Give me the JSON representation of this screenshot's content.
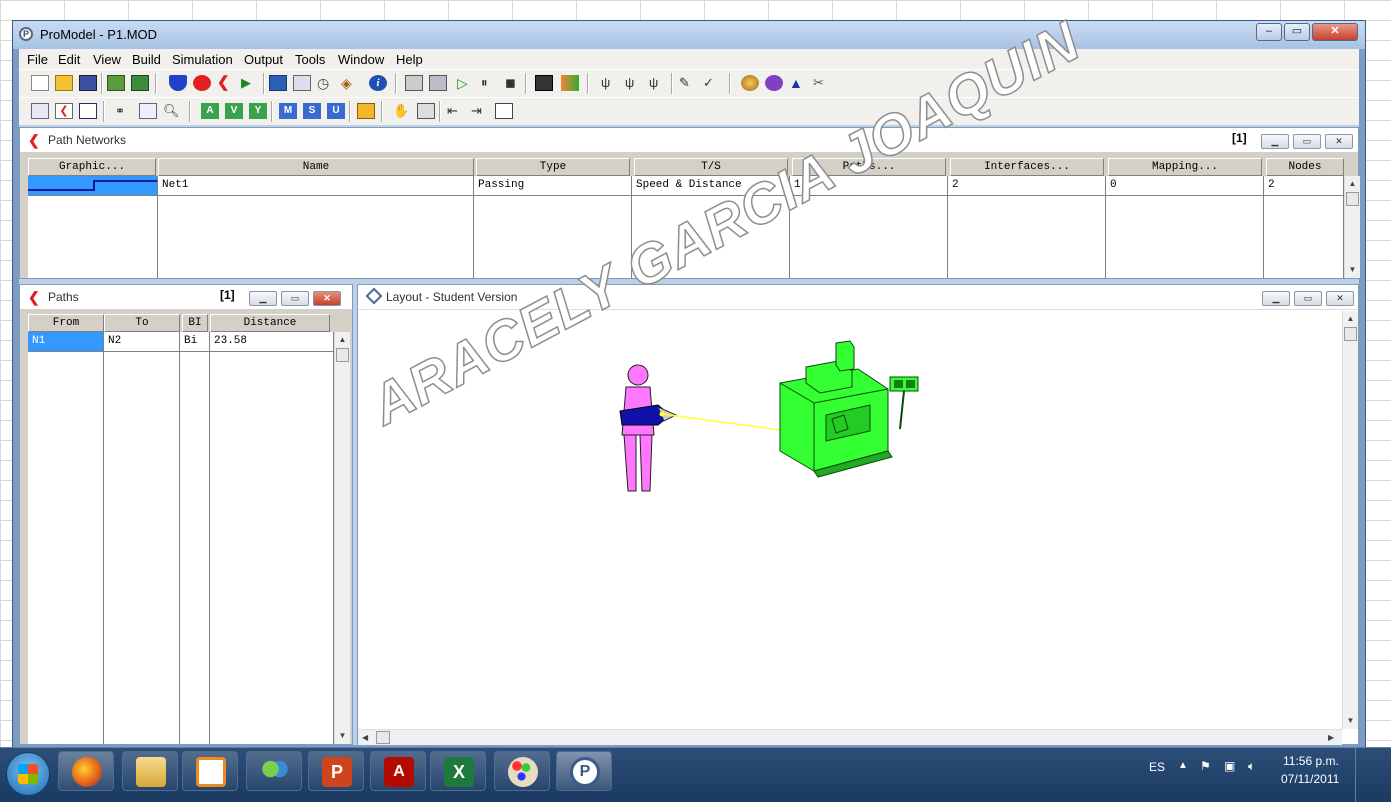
{
  "window": {
    "title": "ProModel - P1.MOD",
    "app_icon": "promodel-icon"
  },
  "menu": [
    "File",
    "Edit",
    "View",
    "Build",
    "Simulation",
    "Output",
    "Tools",
    "Window",
    "Help"
  ],
  "path_networks": {
    "title": "Path Networks",
    "count": "[1]",
    "columns": [
      "Graphic...",
      "Name",
      "Type",
      "T/S",
      "Paths...",
      "Interfaces...",
      "Mapping...",
      "Nodes"
    ],
    "rows": [
      {
        "name": "Net1",
        "type": "Passing",
        "ts": "Speed & Distance",
        "paths": "1",
        "interfaces": "2",
        "mapping": "0",
        "nodes": "2"
      }
    ]
  },
  "paths": {
    "title": "Paths",
    "count": "[1]",
    "columns": [
      "From",
      "To",
      "BI",
      "Distance"
    ],
    "rows": [
      {
        "from": "N1",
        "to": "N2",
        "bi": "Bi",
        "distance": "23.58"
      }
    ]
  },
  "layout": {
    "title": "Layout - Student Version"
  },
  "watermark": "ARACELY GARCIA JOAQUIN",
  "taskbar": {
    "apps": [
      "firefox-icon",
      "explorer-icon",
      "media-player-icon",
      "messenger-icon",
      "powerpoint-icon",
      "acrobat-icon",
      "excel-icon",
      "paint-icon",
      "promodel-icon"
    ],
    "language": "ES",
    "time": "11:56 p.m.",
    "date": "07/11/2011"
  },
  "colors": {
    "selected_cell": "#3399ff",
    "machine_green": "#33ff33",
    "worker_pink": "#ff77ff",
    "path_line": "#ffff33",
    "mdi_bg": "#bcd0ea"
  }
}
